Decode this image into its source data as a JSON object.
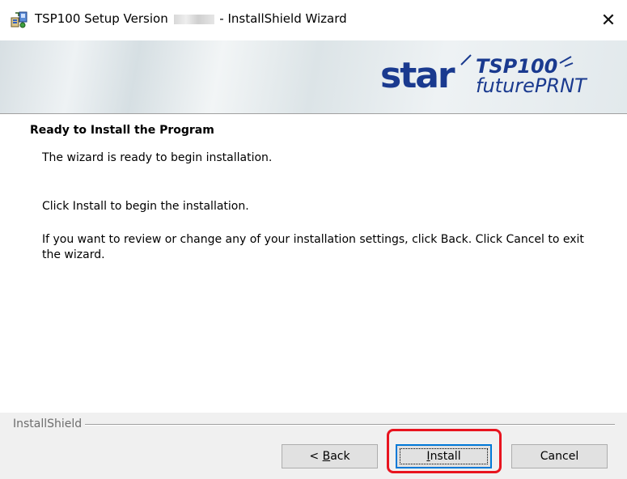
{
  "window": {
    "title_prefix": "TSP100 Setup Version",
    "title_suffix": "- InstallShield Wizard",
    "close_glyph": "✕"
  },
  "banner": {
    "brand": "star",
    "product_line1": "TSP100",
    "product_line2": "futurePRNT",
    "colors": {
      "brand_blue": "#1a3a8f"
    }
  },
  "content": {
    "heading": "Ready to Install the Program",
    "paragraphs": [
      "The wizard is ready to begin installation.",
      "Click Install to begin the installation.",
      "If you want to review or change any of your installation settings, click Back. Click Cancel to exit the wizard."
    ]
  },
  "footer": {
    "label": "InstallShield",
    "buttons": {
      "back": {
        "prefix": "< ",
        "mnemonic": "B",
        "rest": "ack"
      },
      "install": {
        "mnemonic": "I",
        "rest": "nstall"
      },
      "cancel": {
        "label": "Cancel"
      }
    }
  },
  "colors": {
    "highlight": "#e8141f",
    "focus_blue": "#0078d7",
    "dialog_bg": "#f0f0f0"
  }
}
